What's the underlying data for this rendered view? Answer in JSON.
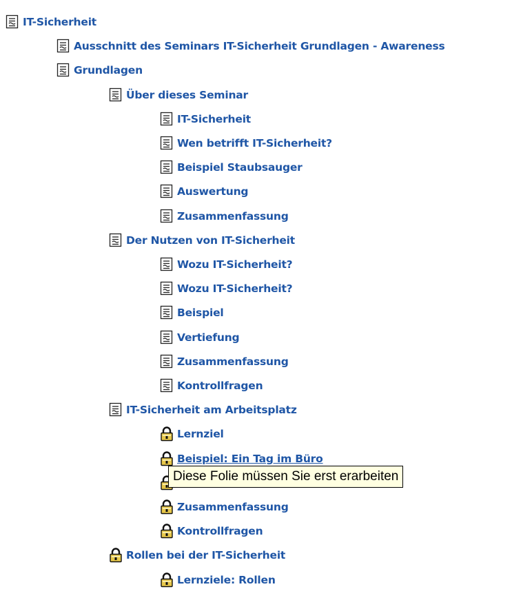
{
  "tree": {
    "items": [
      {
        "label": "IT-Sicherheit",
        "icon": "document-icon",
        "level": 0
      },
      {
        "label": "Ausschnitt des Seminars IT-Sicherheit Grundlagen - Awareness",
        "icon": "document-icon",
        "level": 1
      },
      {
        "label": "Grundlagen",
        "icon": "document-icon",
        "level": 1
      },
      {
        "label": "Über dieses Seminar",
        "icon": "document-icon",
        "level": 2
      },
      {
        "label": "IT-Sicherheit",
        "icon": "document-icon",
        "level": 3
      },
      {
        "label": "Wen betrifft IT-Sicherheit?",
        "icon": "document-icon",
        "level": 3
      },
      {
        "label": "Beispiel Staubsauger",
        "icon": "document-icon",
        "level": 3
      },
      {
        "label": "Auswertung",
        "icon": "document-icon",
        "level": 3
      },
      {
        "label": "Zusammenfassung",
        "icon": "document-icon",
        "level": 3
      },
      {
        "label": "Der Nutzen von IT-Sicherheit",
        "icon": "document-icon",
        "level": 2
      },
      {
        "label": "Wozu IT-Sicherheit?",
        "icon": "document-icon",
        "level": 3
      },
      {
        "label": "Wozu IT-Sicherheit?",
        "icon": "document-icon",
        "level": 3
      },
      {
        "label": "Beispiel",
        "icon": "document-icon",
        "level": 3
      },
      {
        "label": "Vertiefung",
        "icon": "document-icon",
        "level": 3
      },
      {
        "label": "Zusammenfassung",
        "icon": "document-icon",
        "level": 3
      },
      {
        "label": "Kontrollfragen",
        "icon": "document-icon",
        "level": 3
      },
      {
        "label": "IT-Sicherheit am Arbeitsplatz",
        "icon": "document-icon",
        "level": 2
      },
      {
        "label": "Lernziel",
        "icon": "lock-icon",
        "level": 3
      },
      {
        "label": "Beispiel: Ein Tag im Büro",
        "icon": "lock-icon",
        "level": 3
      },
      {
        "label": "",
        "icon": "lock-icon",
        "level": 3
      },
      {
        "label": "Zusammenfassung",
        "icon": "lock-icon",
        "level": 3
      },
      {
        "label": "Kontrollfragen",
        "icon": "lock-icon",
        "level": 3
      },
      {
        "label": "Rollen bei der IT-Sicherheit",
        "icon": "lock-icon",
        "level": 2
      },
      {
        "label": "Lernziele: Rollen",
        "icon": "lock-icon",
        "level": 3
      }
    ]
  },
  "tooltip": {
    "text": "Diese Folie müssen Sie erst erarbeiten"
  },
  "colors": {
    "link": "#1f56a6",
    "tooltip_bg": "#ffffe1"
  }
}
